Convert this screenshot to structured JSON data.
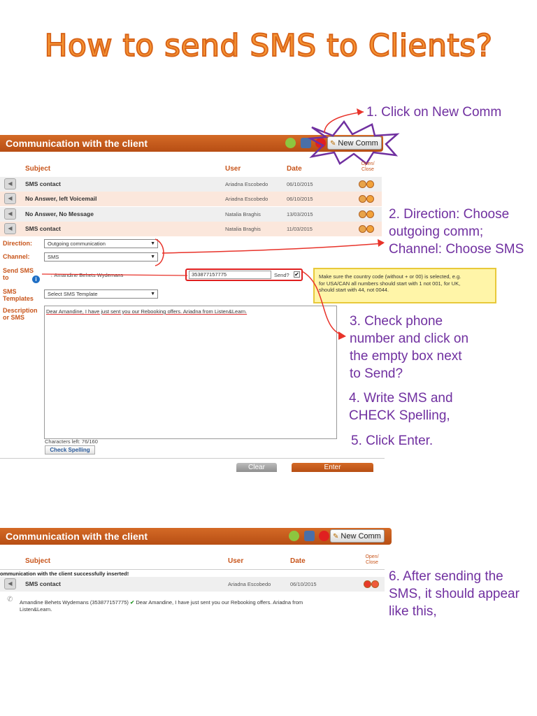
{
  "title": "How to send SMS to Clients?",
  "colors": {
    "accent": "#c8551b",
    "annotation": "#7030a0",
    "arrow": "#e8332a",
    "header": "#c05a1c"
  },
  "annotations": {
    "step1": "1. Click on New Comm",
    "step2_l1": "2. Direction: Choose",
    "step2_l2": "outgoing comm;",
    "step2_l3": "Channel: Choose SMS",
    "step3_l1": "3. Check phone",
    "step3_l2": "number and click on",
    "step3_l3": "the empty box next",
    "step3_l4": "to Send?",
    "step4_l1": "4. Write SMS and",
    "step4_l2": "CHECK Spelling,",
    "step5": "5. Click Enter.",
    "step6_l1": "6. After sending the",
    "step6_l2": "SMS, it should appear",
    "step6_l3": "like this,"
  },
  "panel1": {
    "header": "Communication with the client",
    "new_comm": "New Comm",
    "columns": {
      "subject": "Subject",
      "user": "User",
      "date": "Date",
      "open": "Open/",
      "close": "Close"
    },
    "rows": [
      {
        "subject": "SMS contact",
        "user": "Ariadna Escobedo",
        "date": "06/10/2015"
      },
      {
        "subject": "No Answer, left Voicemail",
        "user": "Ariadna Escobedo",
        "date": "06/10/2015"
      },
      {
        "subject": "No Answer, No Message",
        "user": "Natalia Braghis",
        "date": "13/03/2015"
      },
      {
        "subject": "SMS contact",
        "user": "Natalia Braghis",
        "date": "11/03/2015"
      }
    ],
    "form": {
      "direction_label": "Direction:",
      "direction_value": "Outgoing communication",
      "channel_label": "Channel:",
      "channel_value": "SMS",
      "send_sms_label_1": "Send SMS",
      "send_sms_label_2": "to",
      "recipient": "Amandine Behets Wydemans",
      "phone": "353877157775",
      "send_label": "Send?",
      "templates_label_1": "SMS",
      "templates_label_2": "Templates",
      "template_value": "Select SMS Template",
      "description_label_1": "Description",
      "description_label_2": "or SMS",
      "message": "Dear Amandine, I have just sent you our Rebooking offers. Ariadna from Listen&Learn.",
      "chars_left": "Characters left: 76/160",
      "check_spelling": "Check Spelling",
      "clear": "Clear",
      "enter": "Enter"
    },
    "tip": {
      "l1": "Make sure the country code (without + or 00) is selected, e.g.",
      "l2": "for USA/CAN all numbers should start with 1 not 001, for UK,",
      "l3": "should start with 44, not 0044."
    }
  },
  "panel2": {
    "header": "Communication with the client",
    "new_comm": "New Comm",
    "columns": {
      "subject": "Subject",
      "user": "User",
      "date": "Date",
      "open": "Open/",
      "close": "Close"
    },
    "success": "ommunication with the client successfully inserted!",
    "row": {
      "subject": "SMS contact",
      "user": "Ariadna Escobedo",
      "date": "06/10/2015"
    },
    "detail_name": "Amandine Behets Wydemans (353877157775)",
    "detail_msg_1": "Dear Amandine, I have just sent you our Rebooking offers. Ariadna from",
    "detail_msg_2": "Listen&Learn."
  }
}
